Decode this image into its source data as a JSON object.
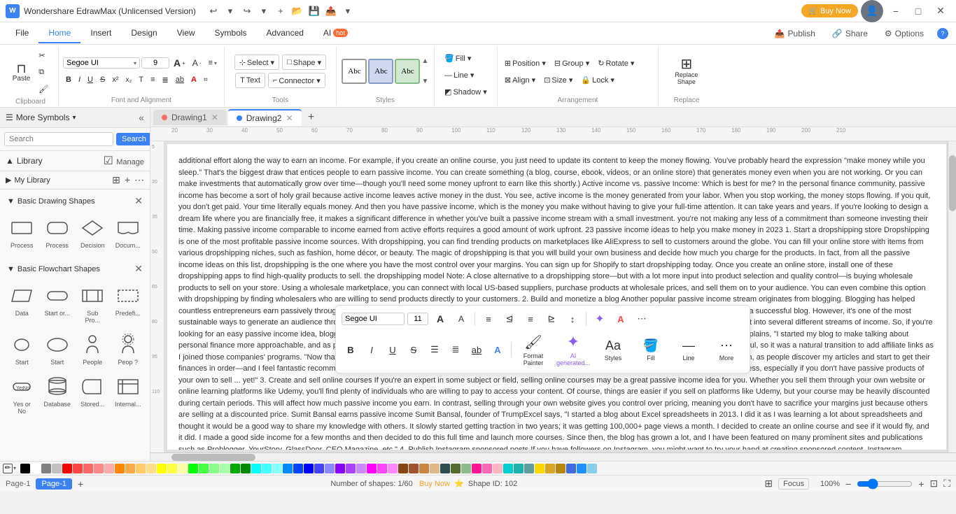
{
  "app": {
    "title": "Wondershare EdrawMax (Unlicensed Version)",
    "logo": "W"
  },
  "title_buttons": {
    "buy_now": "🛒 Buy Now",
    "minimize": "−",
    "maximize": "□",
    "close": "✕"
  },
  "quick_access": {
    "undo": "↩",
    "redo": "↪",
    "new": "+",
    "open": "📁",
    "save": "💾",
    "export": "📤",
    "more": "▾"
  },
  "ribbon_tabs": [
    {
      "id": "file",
      "label": "File",
      "active": false
    },
    {
      "id": "home",
      "label": "Home",
      "active": true
    },
    {
      "id": "insert",
      "label": "Insert",
      "active": false
    },
    {
      "id": "design",
      "label": "Design",
      "active": false
    },
    {
      "id": "view",
      "label": "View",
      "active": false
    },
    {
      "id": "symbols",
      "label": "Symbols",
      "active": false
    },
    {
      "id": "advanced",
      "label": "Advanced",
      "active": false
    },
    {
      "id": "ai",
      "label": "AI",
      "active": false,
      "badge": "hot"
    }
  ],
  "ribbon_right": {
    "publish": "Publish",
    "share": "Share",
    "options": "Options",
    "help": "?"
  },
  "clipboard_group": {
    "label": "Clipboard",
    "paste": "⊓",
    "cut": "✂",
    "copy_format": "🖌",
    "copy": "⧉"
  },
  "font_group": {
    "label": "Font and Alignment",
    "font_name": "Segoe UI",
    "font_size": "9",
    "bold": "B",
    "italic": "I",
    "underline": "U",
    "strikethrough": "S",
    "superscript": "x²",
    "subscript": "x₂",
    "text_transform": "T",
    "bullet_list": "≡",
    "num_list": "≣",
    "underline2": "ab",
    "font_color": "A",
    "increase_font": "A+",
    "decrease_font": "A-",
    "align": "≡",
    "dialog": "⌗"
  },
  "tools_group": {
    "label": "Tools",
    "select_label": "Select ▾",
    "shape_label": "Shape ▾",
    "text_label": "Text",
    "connector_label": "Connector ▾"
  },
  "styles_group": {
    "label": "Styles",
    "boxes": [
      "Abc",
      "Abc",
      "Abc"
    ],
    "more": "▾"
  },
  "fill_group": {
    "label": "",
    "fill": "Fill ▾",
    "line": "Line ▾",
    "shadow": "Shadow ▾"
  },
  "arrangement_group": {
    "label": "Arrangement",
    "position": "Position ▾",
    "group": "Group ▾",
    "rotate": "Rotate ▾",
    "align": "Align ▾",
    "size": "Size ▾",
    "lock": "Lock ▾"
  },
  "replace_group": {
    "label": "Replace",
    "replace_shape": "Replace Shape"
  },
  "left_panel": {
    "title": "More Symbols",
    "search_placeholder": "Search",
    "search_btn": "Search",
    "library_label": "Library",
    "manage_label": "Manage",
    "my_library": "My Library",
    "sections": [
      {
        "id": "basic-drawing",
        "title": "Basic Drawing Shapes",
        "expanded": true,
        "shapes": [
          {
            "label": "Process",
            "shape": "rect"
          },
          {
            "label": "Process",
            "shape": "rect-round"
          },
          {
            "label": "Decision",
            "shape": "diamond"
          },
          {
            "label": "Docum...",
            "shape": "document"
          }
        ]
      },
      {
        "id": "basic-flowchart",
        "title": "Basic Flowchart Shapes",
        "expanded": true,
        "shapes": [
          {
            "label": "Data",
            "shape": "parallelogram"
          },
          {
            "label": "Start or...",
            "shape": "rounded-rect"
          },
          {
            "label": "Sub Pro...",
            "shape": "sub-process"
          },
          {
            "label": "Predefi...",
            "shape": "predefined"
          },
          {
            "label": "Start",
            "shape": "circle"
          },
          {
            "label": "Start",
            "shape": "oval"
          },
          {
            "label": "People",
            "shape": "people"
          },
          {
            "label": "People",
            "shape": "people2"
          },
          {
            "label": "Yes or No",
            "shape": "yes-no"
          },
          {
            "label": "Database",
            "shape": "cylinder"
          },
          {
            "label": "Stored...",
            "shape": "stored"
          },
          {
            "label": "Internal...",
            "shape": "internal"
          }
        ]
      }
    ]
  },
  "doc_tabs": [
    {
      "id": "drawing1",
      "label": "Drawing1",
      "color": "#ff6b6b",
      "active": false
    },
    {
      "id": "drawing2",
      "label": "Drawing2",
      "color": "#3b82f6",
      "active": true
    }
  ],
  "canvas": {
    "text": "additional effort along the way to earn an income. For example, if you create an online course, you just need to update its content to keep the money flowing. You've probably heard the expression \"make money while you sleep.\" That's the biggest draw that entices people to earn passive income. You can create something (a blog, course, ebook, videos, or an online store) that generates money even when you are not working. Or you can make investments that automatically grow over time—though you'll need some money upfront to earn like this shortly.) Active income vs. passive Income: Which is best for me? In the personal finance community, passive income has become a sort of holy grail because active income leaves active money in the dust. You see, active income is the money generated from your labor. When you stop working, the money stops flowing. If you quit, you don't get paid. Your time literally equals money. And then you have passive income, which is the money you make without having to give your full-time attention. It can take years and years. If you're looking to design a dream life where you are financially free, it makes a significant difference in whether you've built a passive income stream with a small investment.\n\nyou're not making any less of a commitment than someone investing their time. Making passive income comparable to income earned from active efforts requires a good amount of work upfront. 23 passive income ideas to help you make money in 2023 1. Start a dropshipping store Dropshipping is one of the most profitable passive income sources. With dropshipping, you can find trending products on marketplaces like AliExpress to sell to customers around the globe. You can fill your online store with items from various dropshipping niches, such as fashion, home décor, or beauty. The magic of dropshipping is that you will build your own business and decide how much you charge for the products. In fact, from all the passive income ideas on this list, dropshipping is the one where you have the most control over your margins. You can sign up for Shopify to start dropshipping today. Once you create an online store, install one of these dropshipping apps to find high-quality products to sell. the dropshipping model Note: A close alternative to a dropshipping store—but with a lot more input into product selection and quality control—is buying wholesale products to sell on your store. Using a wholesale marketplace, you can connect with local US-based suppliers, purchase products at wholesale prices, and sell them on to your audience. You can even combine this option with dropshipping by finding wholesalers who are willing to send products directly to your customers. 2. Build and monetize a blog Another popular passive income stream originates from blogging. Blogging has helped countless entrepreneurs earn passively through affiliate links, courses, sponsored posts, products, book deals, etc. It can indeed take quite a bit of upfront work to build a successful blog. However, it's one of the most sustainable ways to generate an audience through organic and social traffic or building an email list. The biggest perk of having a blog is that you can turn that one asset into several different streams of income. So, if you're looking for an easy passive income idea, blogging might be the perfect option for you. Desirae Odjick makes passive income Desirae Odjick, founder of Half Banked, explains, \"I started my blog to make talking about personal finance more approachable, and as part of that, I tend to share a lot of personal stories. They often included shout-outs to the tools I was using and found helpful, so it was a natural transition to add affiliate links as I joined those companies' programs. \"Now that I've been covering personal finance for almost four years on my blog, those links reliably bring in four figures every month, as people discover my articles and start to get their finances in order—and I feel fantastic recommending them, because I do personally use all of my affiliate products. It's a great way to add passive income to your business, especially if you don't have passive products of your own to sell ... yet!\" 3. Create and sell online courses If you're an expert in some subject or field, selling online courses may be a great passive income idea for you. Whether you sell them through your own website or online learning platforms like Udemy, you'll find plenty of individuals who are willing to pay to access your content. Of course, things are easier if you sell on platforms like Udemy, but your course may be heavily discounted during certain periods. This will affect how much passive income you earn. In contrast, selling through your own website gives you control over pricing, meaning you don't have to sacrifice your margins just because others are selling at a discounted price. Sumit Bansal earns passive income Sumit Bansal, founder of TrumpExcel says, \"I started a blog about Excel spreadsheets in 2013. I did it as I was learning a lot about spreadsheets and thought it would be a good way to share my knowledge with others. It slowly started getting traction in two years; it was getting 100,000+ page views a month. I decided to create an online course and see if it would fly, and it did. I made a good side income for a few months and then decided to do this full time and launch more courses. Since then, the blog has grown a lot, and I have been featured on many prominent sites and publications such as Problogger, YourStory, GlassDoor, CEO Magazine, etc.\" 4. Publish Instagram sponsored posts If you have followers on Instagram, you might want to try your hand at creating sponsored content. Instagram sponsored posts are content pieces that endorse a specific product or service (usually owned by the sponsoring party). Sponsors compensate publishers for creating and distributing content that promotes their business. The secret to getting sponsored is to get more Instagram followers. You'll also want to be super consistent with the type of content you post so sponsors know what to expect. And be sure to focus on just one niche—brands prefer creators who can publish quality content around a specific"
  },
  "floating_toolbar": {
    "font_name": "Segoe UI",
    "font_size": "11",
    "bold": "B",
    "italic": "I",
    "underline": "U",
    "strikethrough": "S",
    "align_menu": "≡",
    "align_left": "≡",
    "align_center": "≡",
    "align_right": "≡",
    "line_spacing": "☰",
    "text_color": "A",
    "format_painter": "Format\nPainter",
    "ai_generated": "AI\ngenerated...",
    "styles": "Styles",
    "fill": "Fill",
    "line": "Line",
    "more": "More"
  },
  "color_bar": {
    "colors": [
      "#000000",
      "#ffffff",
      "#808080",
      "#c0c0c0",
      "#ff0000",
      "#ff4444",
      "#ff6666",
      "#ff8888",
      "#ffaaaa",
      "#ff8800",
      "#ffaa44",
      "#ffcc66",
      "#ffdd88",
      "#ffff00",
      "#ffff44",
      "#ffffaa",
      "#00ff00",
      "#44ff44",
      "#88ff88",
      "#aaffaa",
      "#00aa00",
      "#008800",
      "#00ffff",
      "#44ffff",
      "#88ffff",
      "#0088ff",
      "#0044ff",
      "#0000ff",
      "#4444ff",
      "#8888ff",
      "#8800ff",
      "#aa44ff",
      "#cc88ff",
      "#ff00ff",
      "#ff44ff",
      "#ff88ff",
      "#8b4513",
      "#a0522d",
      "#cd853f",
      "#deb887",
      "#2f4f4f",
      "#556b2f",
      "#8fbc8f",
      "#ff1493",
      "#ff69b4",
      "#ffb6c1",
      "#00ced1",
      "#20b2aa",
      "#5f9ea0",
      "#ffd700",
      "#daa520",
      "#b8860b",
      "#4169e1",
      "#1e90ff",
      "#87ceeb"
    ]
  },
  "status_bar": {
    "page_label": "Page-1",
    "page_tab": "Page-1",
    "add_page": "+",
    "shapes_info": "Number of shapes: 1/60",
    "buy_now": "Buy Now",
    "shape_id": "Shape ID: 102",
    "layers": "⊞",
    "focus": "Focus",
    "zoom_percent": "100%",
    "zoom_minus": "−",
    "zoom_plus": "+",
    "fit_page": "⊡",
    "fullscreen": "⛶"
  }
}
